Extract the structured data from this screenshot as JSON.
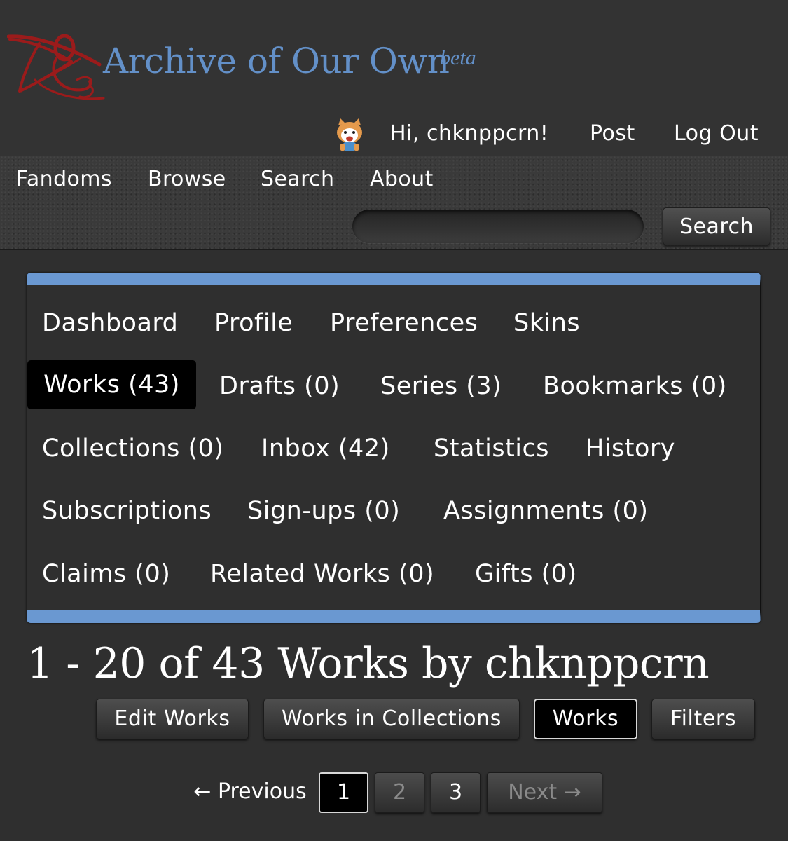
{
  "header": {
    "site_title": "Archive of Our Own",
    "site_beta": "beta",
    "logo_icon": "ao3-logo-icon",
    "user_nav": {
      "avatar_icon": "red-panda-avatar-icon",
      "greeting": "Hi, chknppcrn!",
      "post": "Post",
      "logout": "Log Out"
    }
  },
  "primary_nav": {
    "items": [
      "Fandoms",
      "Browse",
      "Search",
      "About"
    ],
    "search_input_value": "",
    "search_button": "Search"
  },
  "dashboard": {
    "items": [
      "Dashboard",
      "Profile",
      "Preferences",
      "Skins",
      "Works (43)",
      "Drafts (0)",
      "Series (3)",
      "Bookmarks (0)",
      "Collections (0)",
      "Inbox (42)",
      "Statistics",
      "History",
      "Subscriptions",
      "Sign-ups (0)",
      "Assignments (0)",
      "Claims (0)",
      "Related Works (0)",
      "Gifts (0)"
    ],
    "active": "Works (43)"
  },
  "main": {
    "heading": "1 - 20 of 43 Works by chknppcrn",
    "actions": [
      "Edit Works",
      "Works in Collections",
      "Works",
      "Filters"
    ],
    "active_action": "Works"
  },
  "pagination": {
    "previous": "← Previous",
    "pages": [
      "1",
      "2",
      "3"
    ],
    "current_page": "1",
    "next": "Next →"
  },
  "colors": {
    "background": "#2f2f2f",
    "title_blue": "#6390c8",
    "dashboard_accent": "#6a98d1",
    "logo_red": "#9b1b1b"
  }
}
